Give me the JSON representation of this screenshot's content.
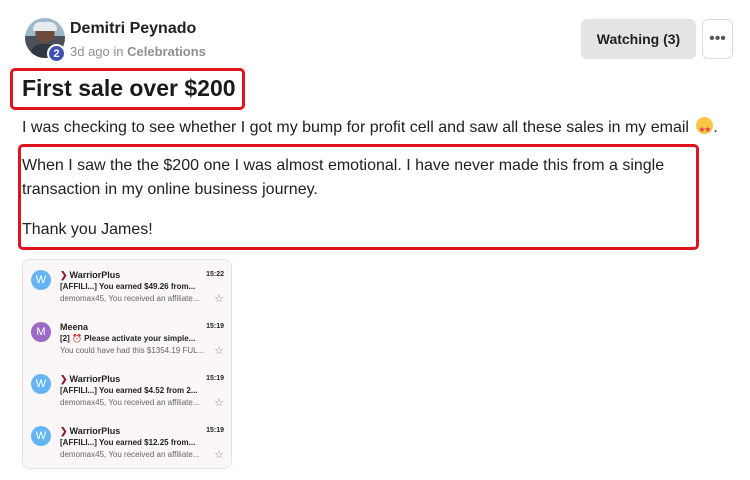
{
  "post": {
    "author": {
      "name": "Demitri Peynado",
      "level": "2"
    },
    "time_ago": "3d ago",
    "in_label": "in",
    "category": "Celebrations",
    "watch_label": "Watching (3)",
    "more_label": "•••",
    "title": "First sale over $200",
    "paragraphs": [
      "I was checking to see whether I got my bump for profit cell and saw all these sales in my email",
      "When I saw the the $200 one I was almost emotional. I have never made this from a single",
      "transaction in my online business journey.",
      "Thank you James!"
    ],
    "paragraph1_suffix": "."
  },
  "screenshot": {
    "emails": [
      {
        "avatar": "W",
        "avatar_color": "#64b5f6",
        "sender": "WarriorPlus",
        "brand": true,
        "time": "15:22",
        "subject": "[AFFILI...] You earned $49.26 from...",
        "preview": "demomax45, You received an affiliate..."
      },
      {
        "avatar": "M",
        "avatar_color": "#9c6ac7",
        "sender": "Meena",
        "brand": false,
        "time": "15:19",
        "subject": "[2] ⏰ Please activate your simple...",
        "preview": "You could have had this $1354.19 FUL..."
      },
      {
        "avatar": "W",
        "avatar_color": "#64b5f6",
        "sender": "WarriorPlus",
        "brand": true,
        "time": "15:19",
        "subject": "[AFFILI...] You earned $4.52 from 2...",
        "preview": "demomax45, You received an affiliate..."
      },
      {
        "avatar": "W",
        "avatar_color": "#64b5f6",
        "sender": "WarriorPlus",
        "brand": true,
        "time": "15:19",
        "subject": "[AFFILI...] You earned $12.25 from...",
        "preview": "demomax45, You received an affiliate..."
      }
    ]
  },
  "colors": {
    "highlight": "#e0141d",
    "badge": "#3f51b5",
    "brand_chevron": "#8b1d3a"
  },
  "icons": {
    "more": "more-horizontal-icon",
    "star": "star-outline-icon",
    "emoji": "star-struck-emoji-icon"
  }
}
